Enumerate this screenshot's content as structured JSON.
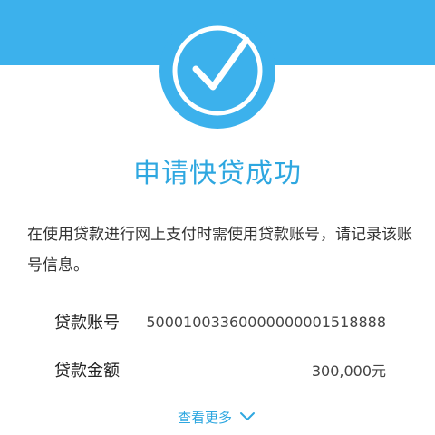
{
  "colors": {
    "accent": "#3cb1ec",
    "title": "#2ea7e0",
    "text": "#333333",
    "background": "#ffffff"
  },
  "header": {
    "icon": "check-circle-icon"
  },
  "title": "申请快贷成功",
  "message": "在使用贷款进行网上支付时需使用贷款账号，请记录该账号信息。",
  "details": {
    "account_label": "贷款账号",
    "account_value": "50001003360000000001518888",
    "amount_label": "贷款金额",
    "amount_value": "300,000元"
  },
  "more": {
    "label": "查看更多",
    "icon": "chevron-down-icon"
  }
}
